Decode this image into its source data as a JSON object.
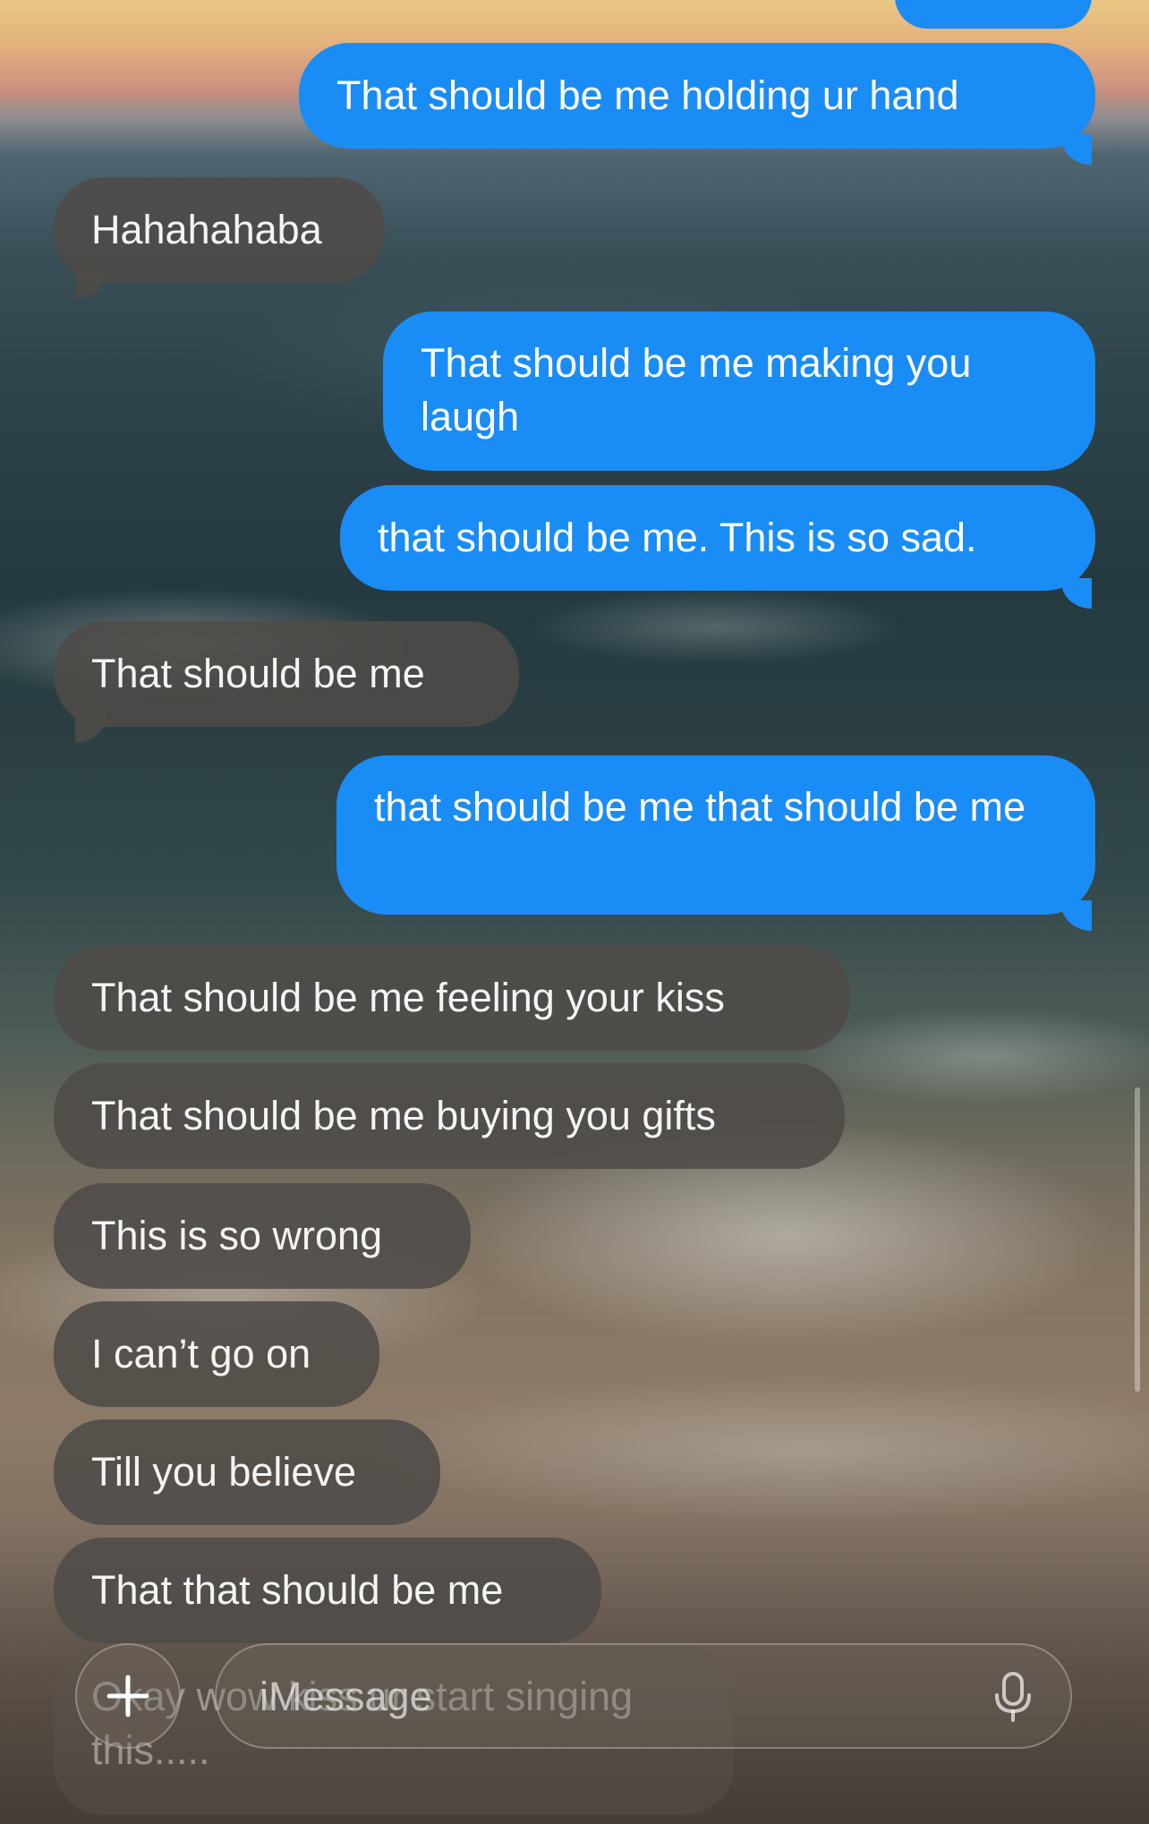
{
  "thread": {
    "messages": [
      {
        "id": "m0",
        "direction": "outgoing",
        "text": ""
      },
      {
        "id": "m1",
        "direction": "outgoing",
        "text": "That should be me holding ur hand"
      },
      {
        "id": "m2",
        "direction": "incoming",
        "text": "Hahahahaba"
      },
      {
        "id": "m3",
        "direction": "outgoing",
        "text": "That should be me making you laugh"
      },
      {
        "id": "m4",
        "direction": "outgoing",
        "text": "that should be me. This is so sad."
      },
      {
        "id": "m5",
        "direction": "incoming",
        "text": "That should be me"
      },
      {
        "id": "m6",
        "direction": "outgoing",
        "text": "that should be me that should be me"
      },
      {
        "id": "m7",
        "direction": "incoming",
        "text": "That should be me feeling your kiss"
      },
      {
        "id": "m8",
        "direction": "incoming",
        "text": "That should be me buying you gifts"
      },
      {
        "id": "m9",
        "direction": "incoming",
        "text": "This is so wrong"
      },
      {
        "id": "m10",
        "direction": "incoming",
        "text": "I can’t go on"
      },
      {
        "id": "m11",
        "direction": "incoming",
        "text": "Till you believe"
      },
      {
        "id": "m12",
        "direction": "incoming",
        "text": "That that should be me"
      },
      {
        "id": "m13",
        "direction": "incoming",
        "text": "Okay wow kiss ur start singing this....."
      }
    ]
  },
  "composer": {
    "placeholder": "iMessage",
    "plus_icon": "plus-icon",
    "mic_icon": "microphone-icon"
  },
  "colors": {
    "outgoing_bubble": "#1a8cf6",
    "incoming_bubble": "#4e4b48",
    "text": "#ffffff"
  }
}
